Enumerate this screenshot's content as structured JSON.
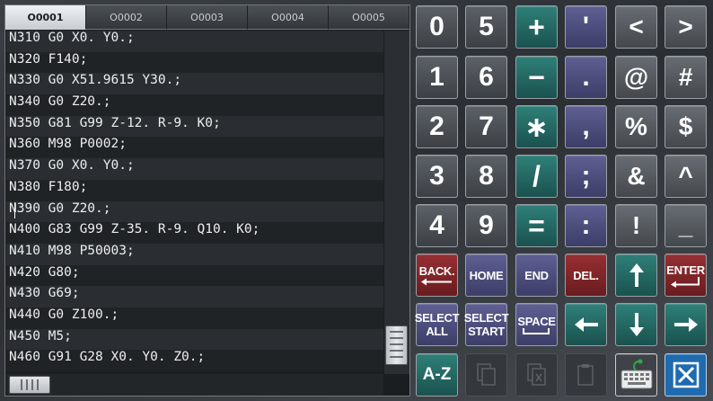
{
  "tabs": [
    {
      "label": "O0001",
      "active": true
    },
    {
      "label": "O0002",
      "active": false
    },
    {
      "label": "O0003",
      "active": false
    },
    {
      "label": "O0004",
      "active": false
    },
    {
      "label": "O0005",
      "active": false
    }
  ],
  "code_lines": [
    "N310 G0 X0. Y0.;",
    "N320 F140;",
    "N330 G0 X51.9615 Y30.;",
    "N340 G0 Z20.;",
    "N350 G81 G99 Z-12. R-9. K0;",
    "N360 M98 P0002;",
    "N370 G0 X0. Y0.;",
    "N380 F180;",
    "N390 G0 Z20.;",
    "N400 G83 G99 Z-35. R-9. Q10. K0;",
    "N410 M98 P50003;",
    "N420 G80;",
    "N430 G69;",
    "N440 G0 Z100.;",
    "N450 M5;",
    "N460 G91 G28 X0. Y0. Z0.;"
  ],
  "keys": {
    "k0": "0",
    "k5": "5",
    "plus": "+",
    "quote": "'",
    "lt": "<",
    "gt": ">",
    "k1": "1",
    "k6": "6",
    "minus": "−",
    "dot": ".",
    "at": "@",
    "hash": "#",
    "k2": "2",
    "k7": "7",
    "star": "∗",
    "comma": ",",
    "pct": "%",
    "dollar": "$",
    "k3": "3",
    "k8": "8",
    "slash": "/",
    "semi": ";",
    "amp": "&",
    "caret": "^",
    "k4": "4",
    "k9": "9",
    "eq": "=",
    "colon": ":",
    "excl": "!",
    "under": "_",
    "back": "BACK.",
    "home": "HOME",
    "end": "END",
    "del": "DEL.",
    "enter": "ENTER",
    "select_all_1": "SELECT",
    "select_all_2": "ALL",
    "select_start_1": "SELECT",
    "select_start_2": "START",
    "space": "SPACE",
    "az": "A-Z"
  },
  "icons": {
    "up": "arrow-up-icon",
    "down": "arrow-down-icon",
    "left": "arrow-left-icon",
    "right": "arrow-right-icon",
    "copy": "copy-icon",
    "cut": "cut-icon",
    "paste": "paste-icon",
    "keyboard": "keyboard-icon",
    "close": "close-icon"
  },
  "colors": {
    "teal_key": "#2f8079",
    "symbol_key": "#5f5f93",
    "red_key": "#962f33",
    "digit_key": "#5c6167"
  }
}
